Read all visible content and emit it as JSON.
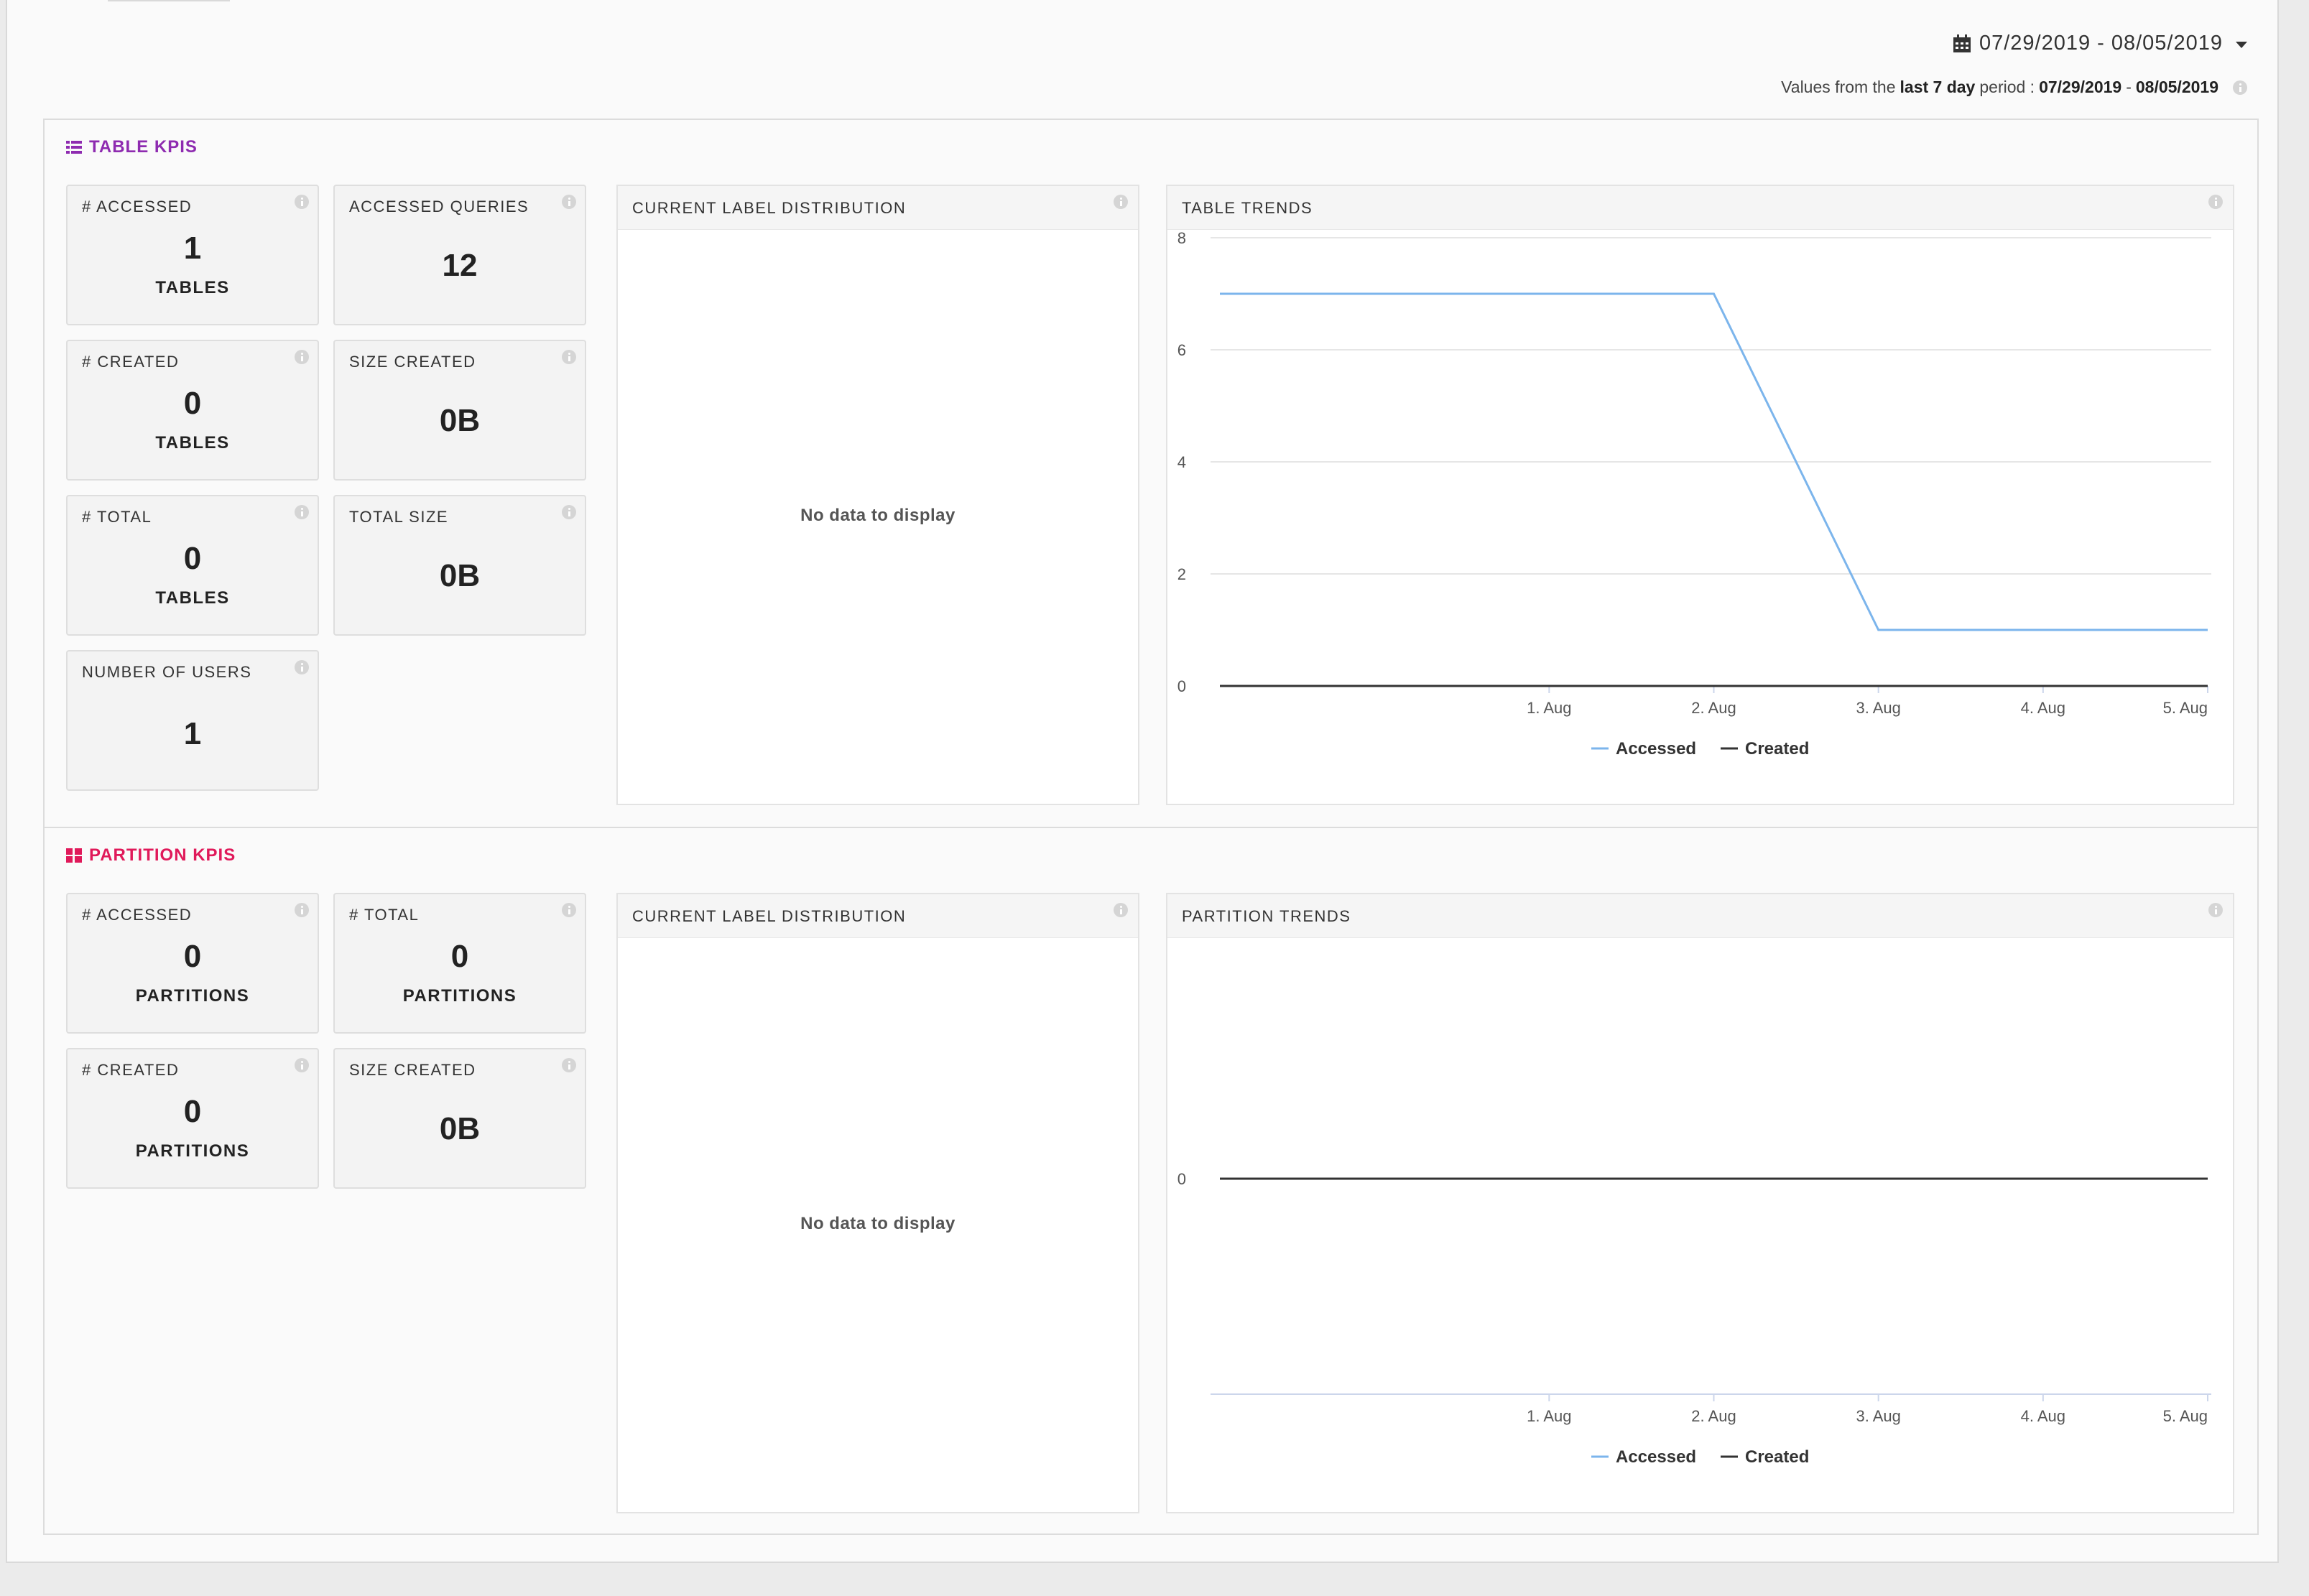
{
  "header": {
    "date_range": "07/29/2019 - 08/05/2019",
    "period_prefix": "Values from the",
    "period_bold": "last 7 day",
    "period_mid": "period :",
    "period_start": "07/29/2019",
    "period_sep": "-",
    "period_end": "08/05/2019"
  },
  "table_section": {
    "title": "TABLE KPIS",
    "kpis": [
      {
        "label": "# ACCESSED",
        "value": "1",
        "unit": "TABLES"
      },
      {
        "label": "ACCESSED QUERIES",
        "value": "12",
        "unit": ""
      },
      {
        "label": "# CREATED",
        "value": "0",
        "unit": "TABLES"
      },
      {
        "label": "SIZE CREATED",
        "value": "0B",
        "unit": ""
      },
      {
        "label": "# TOTAL",
        "value": "0",
        "unit": "TABLES"
      },
      {
        "label": "TOTAL SIZE",
        "value": "0B",
        "unit": ""
      },
      {
        "label": "NUMBER OF USERS",
        "value": "1",
        "unit": ""
      }
    ],
    "label_dist": {
      "title": "CURRENT LABEL DISTRIBUTION",
      "empty": "No data to display"
    },
    "trends": {
      "title": "TABLE TRENDS"
    }
  },
  "partition_section": {
    "title": "PARTITION KPIS",
    "kpis": [
      {
        "label": "# ACCESSED",
        "value": "0",
        "unit": "PARTITIONS"
      },
      {
        "label": "# TOTAL",
        "value": "0",
        "unit": "PARTITIONS"
      },
      {
        "label": "# CREATED",
        "value": "0",
        "unit": "PARTITIONS"
      },
      {
        "label": "SIZE CREATED",
        "value": "0B",
        "unit": ""
      }
    ],
    "label_dist": {
      "title": "CURRENT LABEL DISTRIBUTION",
      "empty": "No data to display"
    },
    "trends": {
      "title": "PARTITION TRENDS"
    }
  },
  "colors": {
    "table_accent": "#8e2bb0",
    "partition_accent": "#e0195a",
    "accessed_series": "#7cb5ec",
    "created_series": "#333333"
  },
  "chart_data": [
    {
      "type": "line",
      "title": "TABLE TRENDS",
      "x": [
        "07/30/2019",
        "07/31/2019",
        "08/01/2019",
        "08/02/2019",
        "08/03/2019",
        "08/04/2019",
        "08/05/2019"
      ],
      "x_ticks": [
        "1. Aug",
        "2. Aug",
        "3. Aug",
        "4. Aug",
        "5. Aug"
      ],
      "y_ticks": [
        "0",
        "2",
        "4",
        "6",
        "8"
      ],
      "ylim": [
        0,
        8
      ],
      "grid": true,
      "legend": "bottom-center",
      "series": [
        {
          "name": "Accessed",
          "values": [
            7,
            7,
            7,
            7,
            1,
            1,
            1
          ]
        },
        {
          "name": "Created",
          "values": [
            0,
            0,
            0,
            0,
            0,
            0,
            0
          ]
        }
      ]
    },
    {
      "type": "line",
      "title": "PARTITION TRENDS",
      "x": [
        "07/30/2019",
        "07/31/2019",
        "08/01/2019",
        "08/02/2019",
        "08/03/2019",
        "08/04/2019",
        "08/05/2019"
      ],
      "x_ticks": [
        "1. Aug",
        "2. Aug",
        "3. Aug",
        "4. Aug",
        "5. Aug"
      ],
      "y_ticks": [
        "0"
      ],
      "grid": false,
      "legend": "bottom-center",
      "series": [
        {
          "name": "Accessed",
          "values": [
            0,
            0,
            0,
            0,
            0,
            0,
            0
          ]
        },
        {
          "name": "Created",
          "values": [
            0,
            0,
            0,
            0,
            0,
            0,
            0
          ]
        }
      ]
    }
  ]
}
